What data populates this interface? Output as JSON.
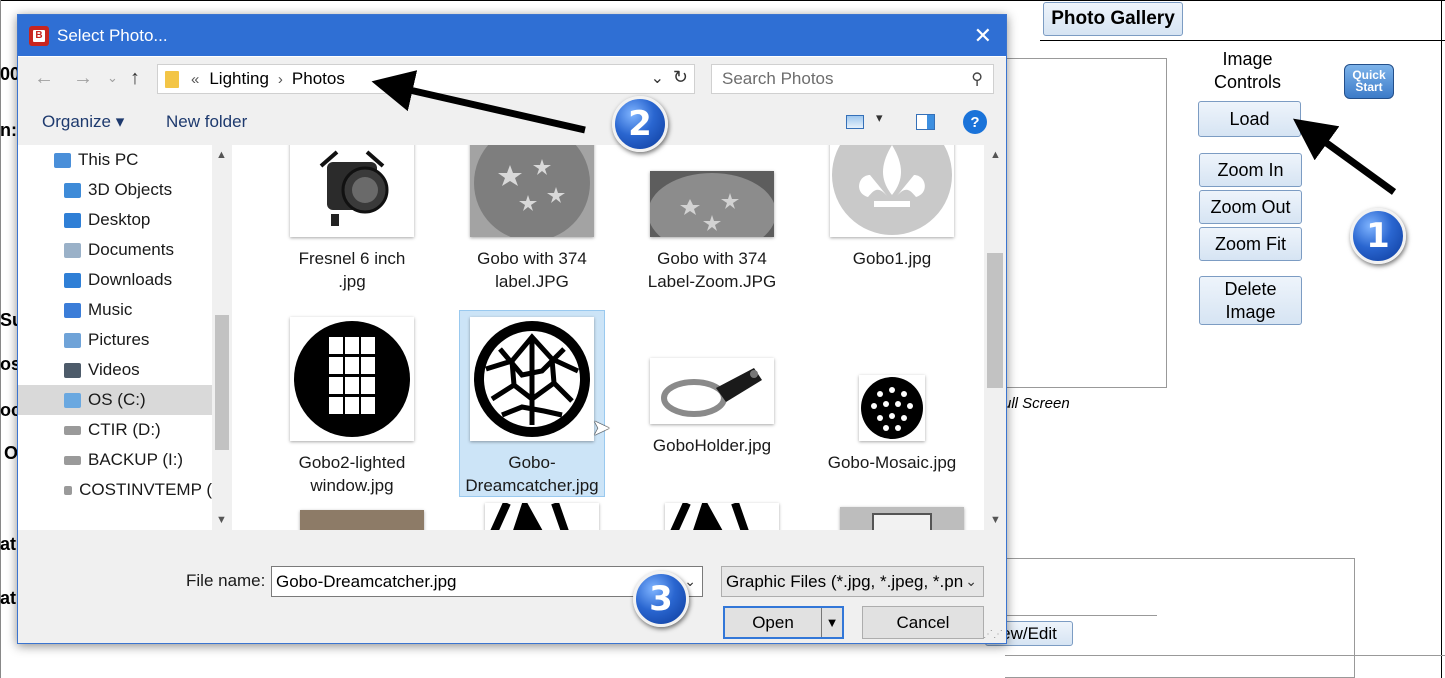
{
  "background_app": {
    "gallery_button": "Photo Gallery",
    "image_controls_label": "Image Controls",
    "load_button": "Load",
    "zoom_in_button": "Zoom In",
    "zoom_out_button": "Zoom Out",
    "zoom_fit_button": "Zoom Fit",
    "delete_image_button": "Delete Image",
    "quick_start_button": "Quick Start",
    "full_screen_label": "ull Screen",
    "view_edit_button": "ew/Edit",
    "left_fragments": [
      "00",
      "n:",
      "Su",
      "os",
      "oc",
      "O",
      "atu",
      "atu"
    ]
  },
  "callouts": [
    "1",
    "2",
    "3"
  ],
  "dialog": {
    "title": "Select Photo...",
    "close_glyph": "✕",
    "breadcrumb": [
      "Lighting",
      "Photos"
    ],
    "breadcrumb_overflow": "«",
    "search_placeholder": "Search Photos",
    "toolbar": {
      "organize": "Organize ▾",
      "new_folder": "New folder",
      "help": "?"
    },
    "nav_items": [
      {
        "label": "This PC",
        "icon": "pc-icon",
        "color": "#4a8fd9"
      },
      {
        "label": "3D Objects",
        "icon": "folder-3d-icon",
        "color": "#3e8bd8"
      },
      {
        "label": "Desktop",
        "icon": "desktop-folder-icon",
        "color": "#2f7fd6"
      },
      {
        "label": "Documents",
        "icon": "documents-folder-icon",
        "color": "#9ab1c8"
      },
      {
        "label": "Downloads",
        "icon": "downloads-folder-icon",
        "color": "#2f7fd6"
      },
      {
        "label": "Music",
        "icon": "music-folder-icon",
        "color": "#3b7dd8"
      },
      {
        "label": "Pictures",
        "icon": "pictures-folder-icon",
        "color": "#6fa3d8"
      },
      {
        "label": "Videos",
        "icon": "videos-folder-icon",
        "color": "#4d5b6a"
      },
      {
        "label": "OS (C:)",
        "icon": "drive-os-icon",
        "color": "#6aa8e0"
      },
      {
        "label": "CTIR (D:)",
        "icon": "drive-icon",
        "color": "#9a9a9a"
      },
      {
        "label": "BACKUP (I:)",
        "icon": "drive-icon",
        "color": "#9a9a9a"
      },
      {
        "label": "COSTINVTEMP (",
        "icon": "drive-icon",
        "color": "#9a9a9a"
      }
    ],
    "selected_nav_index": 8,
    "files": [
      {
        "label": "Fresnel 6 inch .jpg",
        "thumb": "fresnel"
      },
      {
        "label": "Gobo with 374 label.JPG",
        "thumb": "gobo-stars"
      },
      {
        "label": "Gobo with 374 Label-Zoom.JPG",
        "thumb": "gobo-stars-zoom"
      },
      {
        "label": "Gobo1.jpg",
        "thumb": "gobo-fleur"
      },
      {
        "label": "Gobo2-lighted window.jpg",
        "thumb": "gobo-window"
      },
      {
        "label": "Gobo-Dreamcatcher.jpg",
        "thumb": "gobo-dreamcatcher"
      },
      {
        "label": "GoboHolder.jpg",
        "thumb": "gobo-holder"
      },
      {
        "label": "Gobo-Mosaic.jpg",
        "thumb": "gobo-mosaic"
      }
    ],
    "selected_file_index": 5,
    "file_name_label": "File name:",
    "file_name_value": "Gobo-Dreamcatcher.jpg",
    "file_type_value": "Graphic Files (*.jpg, *.jpeg, *.pn",
    "open_button": "Open",
    "cancel_button": "Cancel"
  }
}
